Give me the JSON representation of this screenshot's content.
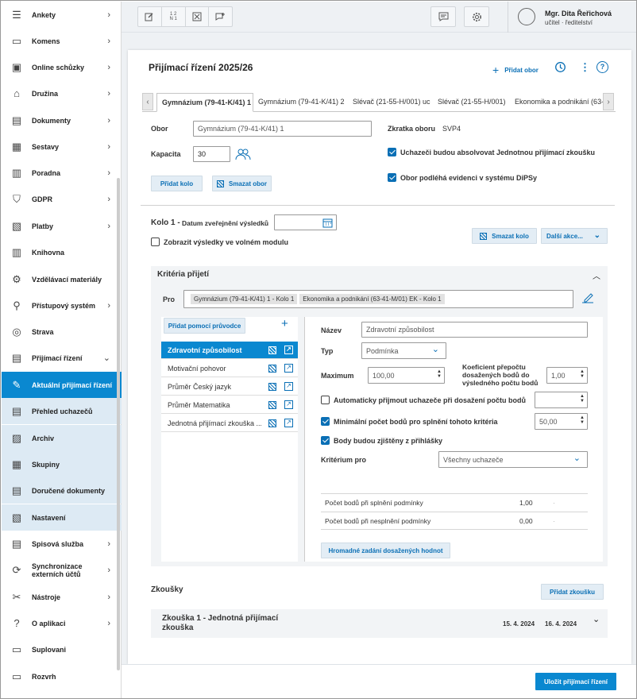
{
  "sidebar": {
    "items": [
      {
        "label": "Ankety",
        "icon": "survey-icon",
        "chev": "›"
      },
      {
        "label": "Komens",
        "icon": "chat-icon",
        "chev": "›"
      },
      {
        "label": "Online schůzky",
        "icon": "video-meeting-icon",
        "chev": "›"
      },
      {
        "label": "Družina",
        "icon": "group-icon",
        "chev": "›"
      },
      {
        "label": "Dokumenty",
        "icon": "document-icon",
        "chev": "›"
      },
      {
        "label": "Sestavy",
        "icon": "report-icon",
        "chev": "›"
      },
      {
        "label": "Poradna",
        "icon": "counseling-icon",
        "chev": "›"
      },
      {
        "label": "GDPR",
        "icon": "shield-icon",
        "chev": "›"
      },
      {
        "label": "Platby",
        "icon": "payment-icon",
        "chev": "›"
      },
      {
        "label": "Knihovna",
        "icon": "library-icon",
        "chev": ""
      },
      {
        "label": "Vzdělávací materiály",
        "icon": "gear-icon",
        "chev": ""
      },
      {
        "label": "Přístupový systém",
        "icon": "access-icon",
        "chev": "›"
      },
      {
        "label": "Strava",
        "icon": "food-icon",
        "chev": ""
      },
      {
        "label": "Přijímací řízení",
        "icon": "admission-icon",
        "chev": "⌄"
      },
      {
        "label": "Aktuální přijímací řízení",
        "icon": "edit-icon",
        "chev": ""
      },
      {
        "label": "Přehled uchazečů",
        "icon": "applicants-icon",
        "chev": ""
      },
      {
        "label": "Archiv",
        "icon": "archive-icon",
        "chev": ""
      },
      {
        "label": "Skupiny",
        "icon": "groups-icon",
        "chev": ""
      },
      {
        "label": "Doručené dokumenty",
        "icon": "inbox-icon",
        "chev": ""
      },
      {
        "label": "Nastavení",
        "icon": "settings-icon",
        "chev": ""
      },
      {
        "label": "Spisová služba",
        "icon": "filing-icon",
        "chev": "›"
      },
      {
        "label": "Synchronizace externích účtů",
        "icon": "sync-icon",
        "chev": "›"
      },
      {
        "label": "Nástroje",
        "icon": "tools-icon",
        "chev": "›"
      },
      {
        "label": "O aplikaci",
        "icon": "help-icon",
        "chev": "›"
      },
      {
        "label": "Suplovani",
        "icon": "substitution-icon",
        "chev": ""
      },
      {
        "label": "Rozvrh",
        "icon": "timetable-icon",
        "chev": ""
      }
    ]
  },
  "topbar": {
    "group_labels": [
      "",
      "1 2\nN 1",
      "",
      ""
    ],
    "user_name": "Mgr. Dita Řeřichová",
    "user_role": "učitel · ředitelství"
  },
  "page": {
    "title": "Přijímací řízení 2025/26",
    "add_field_label": "Přidat obor",
    "tabs": [
      "Gymnázium (79-41-K/41) 1",
      "Gymnázium (79-41-K/41) 2",
      "Slévač (21-55-H/001) uc",
      "Slévač (21-55-H/001)",
      "Ekonomika a podnikání (63-"
    ],
    "obor_label": "Obor",
    "obor_value": "Gymnázium (79-41-K/41) 1",
    "zkratka_label": "Zkratka oboru",
    "zkratka_value": "SVP4",
    "kapacita_label": "Kapacita",
    "kapacita_value": "30",
    "check1": "Uchazeči budou absolvovat Jednotnou přijímací zkoušku",
    "check2": "Obor podléhá evidenci v systému DiPSy",
    "add_round": "Přidat kolo",
    "delete_field": "Smazat obor",
    "round_label": "Kolo 1 -",
    "results_date_label": "Datum zveřejnění výsledků",
    "free_module": "Zobrazit výsledky ve volném modulu",
    "delete_round": "Smazat kolo",
    "more_actions": "Další akce...",
    "criteria_title": "Kritéria přijetí",
    "pro_label": "Pro",
    "pro_chips": [
      "Gymnázium (79-41-K/41) 1 - Kolo 1",
      "Ekonomika a podnikání (63-41-M/01) EK - Kolo 1"
    ],
    "wizard_btn": "Přidat pomocí průvodce",
    "criteria": [
      "Zdravotní způsobilost",
      "Motivační pohovor",
      "Průměr Český jazyk",
      "Průměr Matematika",
      "Jednotná přijímací zkouška ..."
    ],
    "name_label": "Název",
    "name_value": "Zdravotní způsobilost",
    "type_label": "Typ",
    "type_value": "Podmínka",
    "max_label": "Maximum",
    "max_value": "100,00",
    "coef_label": "Koeficient přepočtu dosažených bodů do výsledného počtu bodů",
    "coef_value": "1,00",
    "auto_accept": "Automaticky přijmout uchazeče při dosažení počtu bodů",
    "min_points": "Minimální počet bodů pro splnění tohoto kritéria",
    "min_value": "50,00",
    "from_app": "Body budou zjištěny z přihlášky",
    "crit_for_label": "Kritérium pro",
    "crit_for_value": "Všechny uchazeče",
    "pts_ok_label": "Počet bodů při splnění podmínky",
    "pts_ok_value": "1,00",
    "pts_fail_label": "Počet bodů při nesplnění podmínky",
    "pts_fail_value": "0,00",
    "bulk_btn": "Hromadné zadání dosažených hodnot",
    "exams_title": "Zkoušky",
    "add_exam": "Přidat zkoušku",
    "exam1_name": "Zkouška 1 - Jednotná přijímací zkouška",
    "exam1_d1": "15. 4. 2024",
    "exam1_d2": "16. 4. 2024",
    "save_btn": "Uložit přijímací řízení"
  },
  "colors": {
    "accent": "#0a88d0",
    "link": "#0a6fb5",
    "sub_bg": "#ddeaf4"
  }
}
